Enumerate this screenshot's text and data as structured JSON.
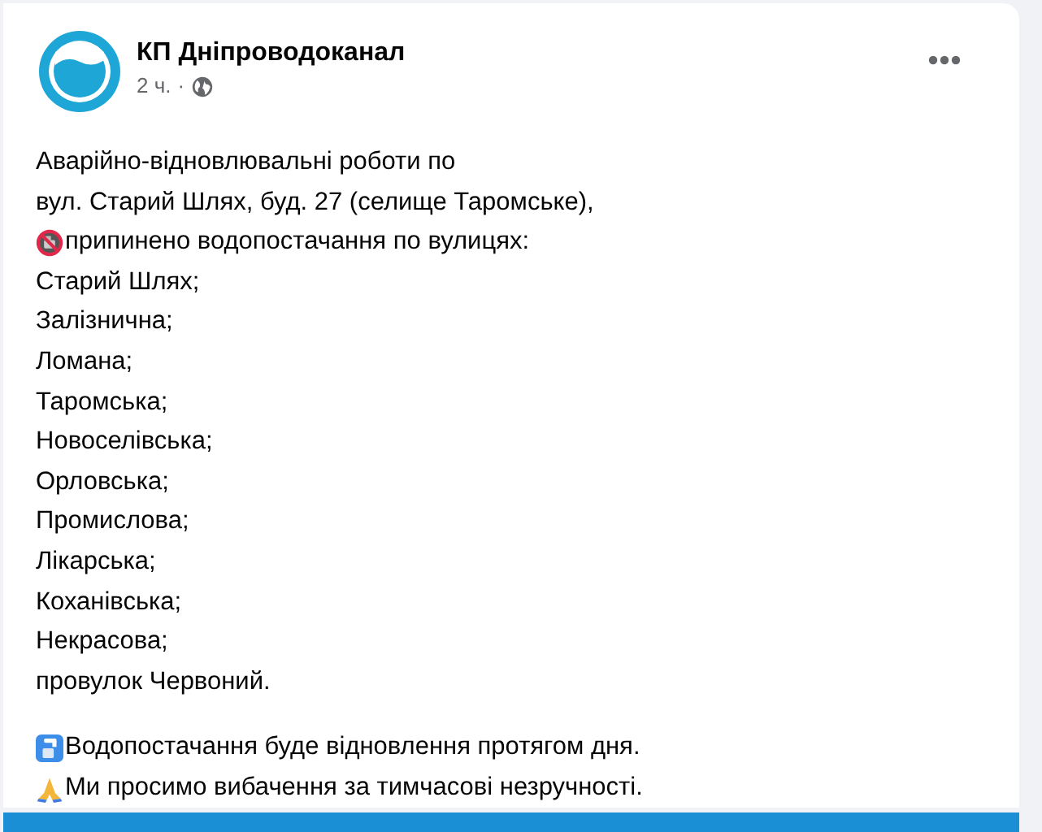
{
  "post": {
    "author": "КП Дніпроводоканал",
    "time": "2 ч.",
    "separator": "·",
    "intro": [
      "Аварійно-відновлювальні роботи по",
      "вул. Старий Шлях, буд. 27 (селище Таромське),"
    ],
    "notice": "припинено водопостачання по вулицях:",
    "streets": [
      "Старий Шлях;",
      "Залізнична;",
      "Ломана;",
      "Таромська;",
      "Новоселівська;",
      "Орловська;",
      "Промислова;",
      "Лікарська;",
      "Коханівська;",
      "Некрасова;",
      "провулок Червоний."
    ],
    "closing": [
      {
        "kind": "tap",
        "text": "Водопостачання буде відновлення протягом дня."
      },
      {
        "kind": "pray",
        "text": "Ми просимо вибачення за тимчасові незручності."
      }
    ]
  }
}
